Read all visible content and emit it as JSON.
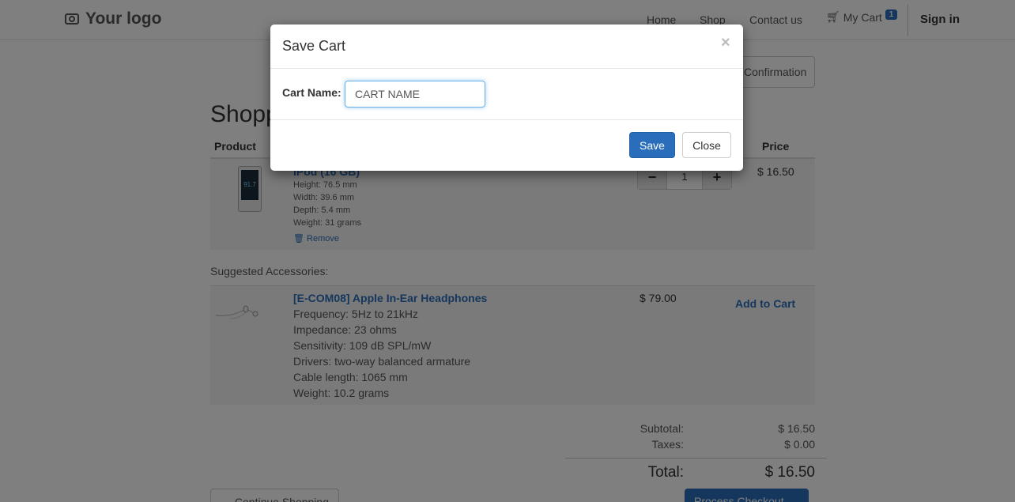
{
  "navbar": {
    "logo_text": "Your logo",
    "links": {
      "home": "Home",
      "shop": "Shop",
      "contact": "Contact us"
    },
    "cart_label": "My Cart",
    "cart_count": "1",
    "sign_in": "Sign in"
  },
  "page": {
    "wizard_step": "Confirmation",
    "title": "Shopp",
    "col_product": "Product",
    "col_price": "Price"
  },
  "cart_item": {
    "name": "iPod (16 GB)",
    "screen_text": "91.7",
    "specs": [
      "Height: 76.5 mm",
      "Width: 39.6 mm",
      "Depth: 5.4 mm",
      "Weight: 31 grams"
    ],
    "remove_label": "Remove",
    "quantity": "1",
    "minus": "−",
    "plus": "+",
    "price": "$ 16.50"
  },
  "suggested": {
    "title": "Suggested Accessories:",
    "name": "[E-COM08] Apple In-Ear Headphones",
    "specs": [
      "Frequency: 5Hz to 21kHz",
      "Impedance: 23 ohms",
      "Sensitivity: 109 dB SPL/mW",
      "Drivers: two-way balanced armature",
      "Cable length: 1065 mm",
      "Weight: 10.2 grams"
    ],
    "price": "$ 79.00",
    "add_label": "Add to Cart"
  },
  "summary": {
    "subtotal_label": "Subtotal:",
    "subtotal": "$ 16.50",
    "taxes_label": "Taxes:",
    "taxes": "$ 0.00",
    "total_label": "Total:",
    "total": "$ 16.50",
    "continue_label": "← Continue Shopping",
    "checkout_label": "Process Checkout →"
  },
  "modal": {
    "title": "Save Cart",
    "close_x": "×",
    "field_label": "Cart Name:",
    "field_value": "CART NAME",
    "save_label": "Save",
    "close_label": "Close"
  },
  "colors": {
    "primary": "#2a6ebb",
    "backdrop": "rgba(0,0,0,0.5)"
  }
}
